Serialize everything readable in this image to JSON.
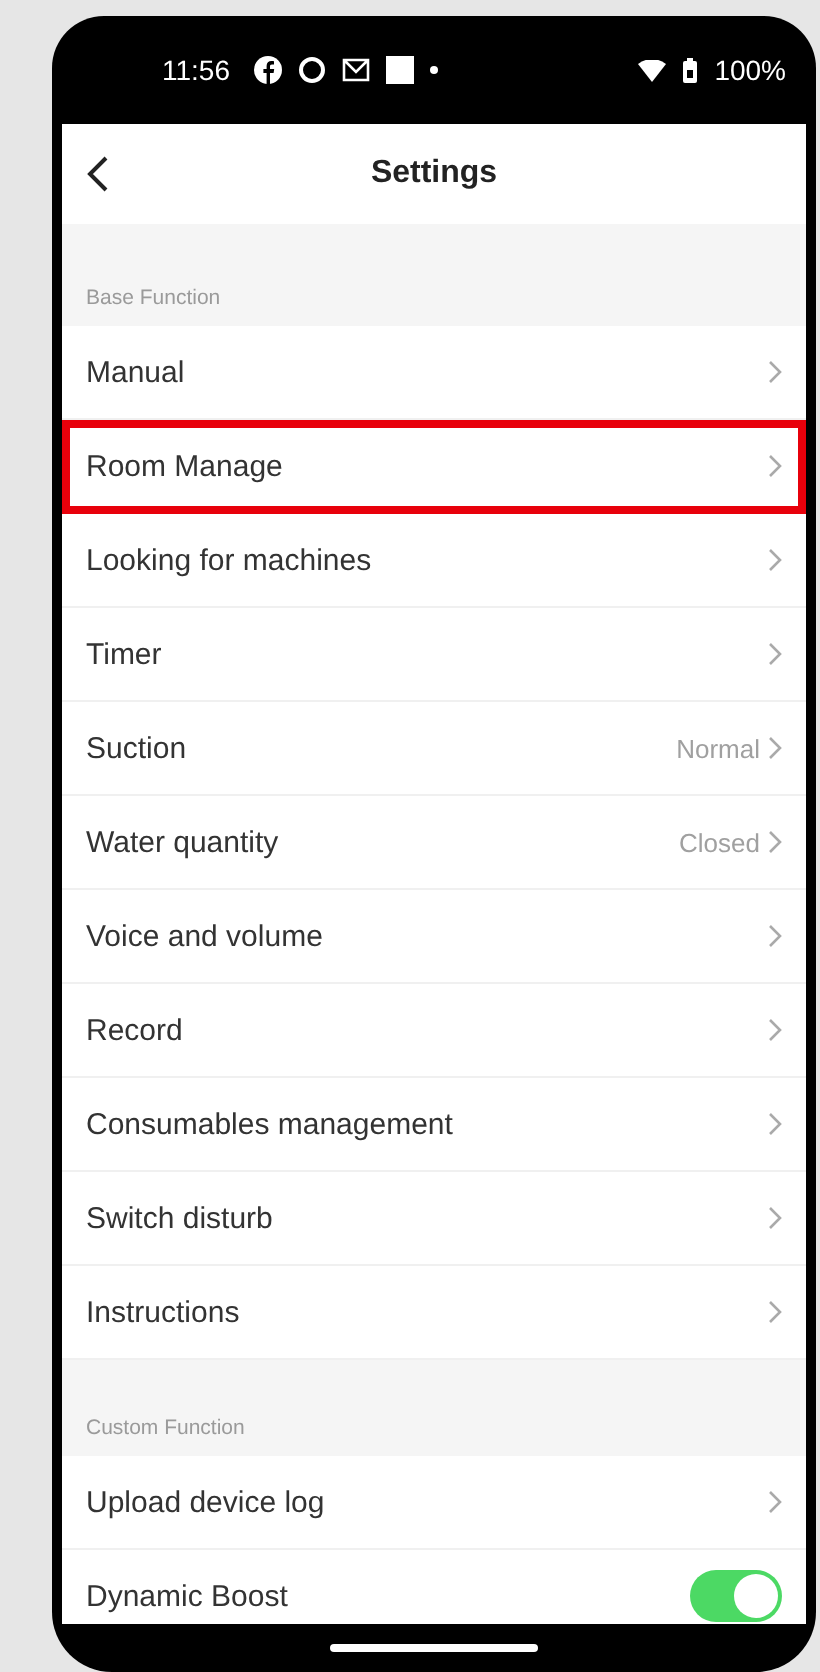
{
  "status_bar": {
    "time": "11:56",
    "battery": "100%"
  },
  "header": {
    "title": "Settings"
  },
  "sections": [
    {
      "title": "Base Function",
      "items": [
        {
          "kind": "link",
          "label": "Manual",
          "highlighted": false
        },
        {
          "kind": "link",
          "label": "Room Manage",
          "highlighted": true
        },
        {
          "kind": "link",
          "label": "Looking for machines",
          "highlighted": false
        },
        {
          "kind": "link",
          "label": "Timer",
          "highlighted": false
        },
        {
          "kind": "link",
          "label": "Suction",
          "value": "Normal",
          "highlighted": false
        },
        {
          "kind": "link",
          "label": "Water quantity",
          "value": "Closed",
          "highlighted": false
        },
        {
          "kind": "link",
          "label": "Voice and volume",
          "highlighted": false
        },
        {
          "kind": "link",
          "label": "Record",
          "highlighted": false
        },
        {
          "kind": "link",
          "label": "Consumables management",
          "highlighted": false
        },
        {
          "kind": "link",
          "label": "Switch disturb",
          "highlighted": false
        },
        {
          "kind": "link",
          "label": "Instructions",
          "highlighted": false
        }
      ]
    },
    {
      "title": "Custom Function",
      "items": [
        {
          "kind": "link",
          "label": "Upload device log",
          "highlighted": false
        },
        {
          "kind": "toggle",
          "label": "Dynamic Boost",
          "on": true,
          "highlighted": false
        }
      ]
    }
  ]
}
